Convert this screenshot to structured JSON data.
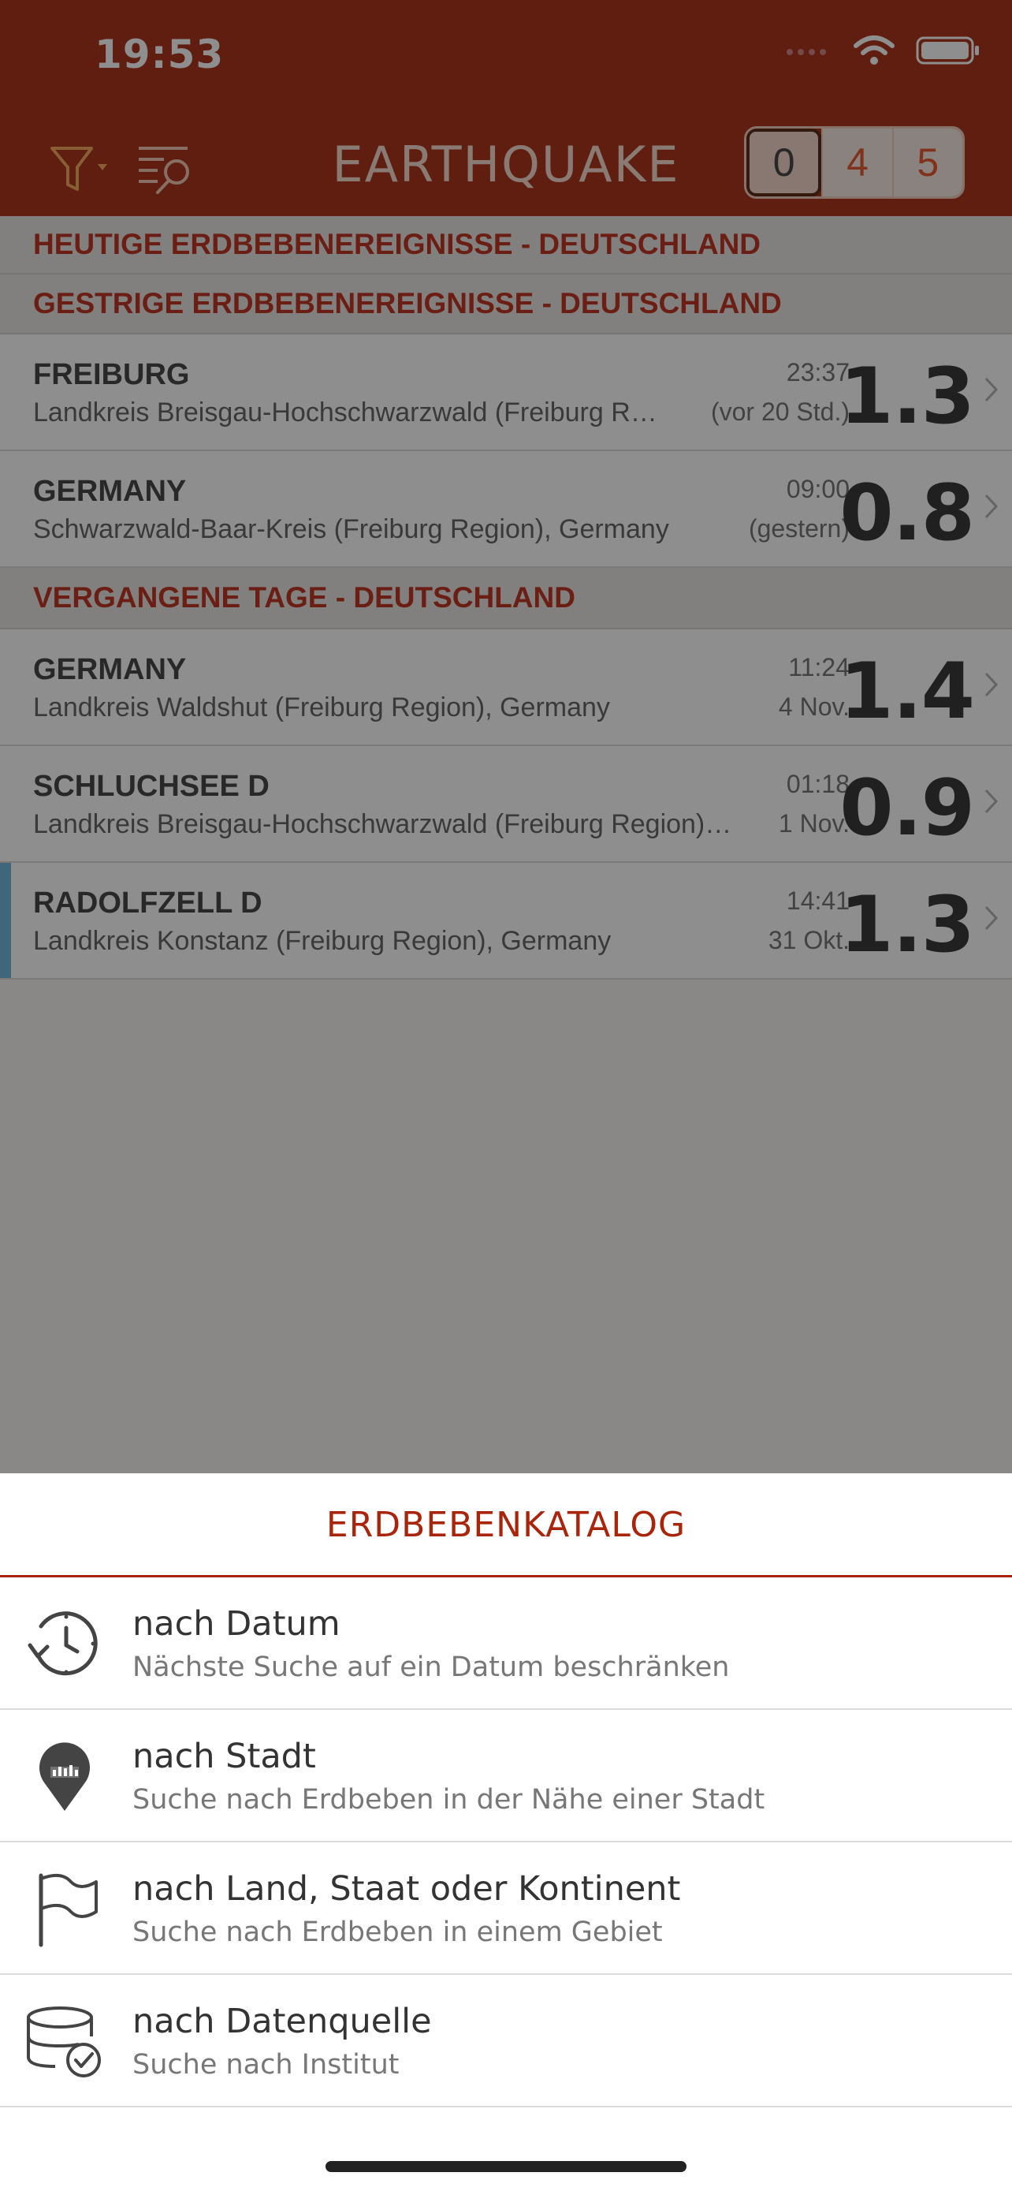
{
  "status_bar": {
    "time": "19:53"
  },
  "navbar": {
    "title": "EARTHQUAKE",
    "segments": [
      "0",
      "4",
      "5"
    ]
  },
  "sections": [
    {
      "header": "HEUTIGE ERDBEBENEREIGNISSE - DEUTSCHLAND"
    },
    {
      "header": "GESTRIGE ERDBEBENEREIGNISSE - DEUTSCHLAND"
    },
    {
      "header": "VERGANGENE TAGE - DEUTSCHLAND"
    }
  ],
  "events": [
    {
      "title": "FREIBURG",
      "subtitle": "Landkreis Breisgau-Hochschwarzwald (Freiburg R…",
      "time": "23:37",
      "when": "(vor 20 Std.)",
      "magnitude": "1.3"
    },
    {
      "title": "GERMANY",
      "subtitle": "Schwarzwald-Baar-Kreis (Freiburg Region), Germany",
      "time": "09:00",
      "when": "(gestern)",
      "magnitude": "0.8"
    },
    {
      "title": "GERMANY",
      "subtitle": "Landkreis Waldshut (Freiburg Region), Germany",
      "time": "11:24",
      "when": "4 Nov.",
      "magnitude": "1.4"
    },
    {
      "title": "SCHLUCHSEE D",
      "subtitle": "Landkreis Breisgau-Hochschwarzwald (Freiburg Region)…",
      "time": "01:18",
      "when": "1 Nov.",
      "magnitude": "0.9"
    },
    {
      "title": "RADOLFZELL D",
      "subtitle": "Landkreis Konstanz (Freiburg Region), Germany",
      "time": "14:41",
      "when": "31 Okt.",
      "magnitude": "1.3"
    }
  ],
  "sheet": {
    "title": "ERDBEBENKATALOG",
    "options": [
      {
        "icon": "clock-history-icon",
        "title": "nach Datum",
        "subtitle": "Nächste Suche auf ein Datum beschränken"
      },
      {
        "icon": "map-pin-icon",
        "title": "nach Stadt",
        "subtitle": "Suche nach Erdbeben in der Nähe einer Stadt"
      },
      {
        "icon": "flag-icon",
        "title": "nach Land, Staat oder Kontinent",
        "subtitle": "Suche nach Erdbeben in einem Gebiet"
      },
      {
        "icon": "database-check-icon",
        "title": "nach Datenquelle",
        "subtitle": "Suche nach Institut"
      }
    ]
  },
  "colors": {
    "brand": "#a01e00",
    "accent_text": "#b8210a",
    "selected_row_accent": "#5fb0d6"
  }
}
